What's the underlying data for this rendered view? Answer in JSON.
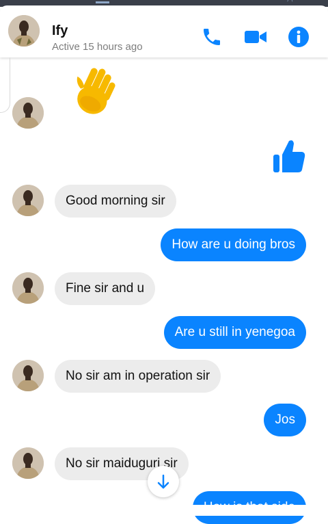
{
  "header": {
    "name": "Ify",
    "status": "Active 15 hours ago"
  },
  "icons": {
    "call": "phone-icon",
    "video": "video-camera-icon",
    "info": "info-icon"
  },
  "colors": {
    "accent": "#0a84ff",
    "incoming_bubble": "#ececec",
    "outgoing_text": "#ffffff"
  },
  "messages": [
    {
      "from": "contact",
      "type": "emoji",
      "emoji": "waving-hand"
    },
    {
      "from": "me",
      "type": "like"
    },
    {
      "from": "contact",
      "type": "text",
      "text": "Good morning sir"
    },
    {
      "from": "me",
      "type": "text",
      "text": "How are u doing bros"
    },
    {
      "from": "contact",
      "type": "text",
      "text": "Fine sir and u"
    },
    {
      "from": "me",
      "type": "text",
      "text": "Are u still in yenegoa"
    },
    {
      "from": "contact",
      "type": "text",
      "text": "No sir am in operation  sir"
    },
    {
      "from": "me",
      "type": "text",
      "text": "Jos"
    },
    {
      "from": "contact",
      "type": "text",
      "text": "No sir maiduguri  sir"
    },
    {
      "from": "me",
      "type": "text",
      "text": "How is that side"
    }
  ]
}
